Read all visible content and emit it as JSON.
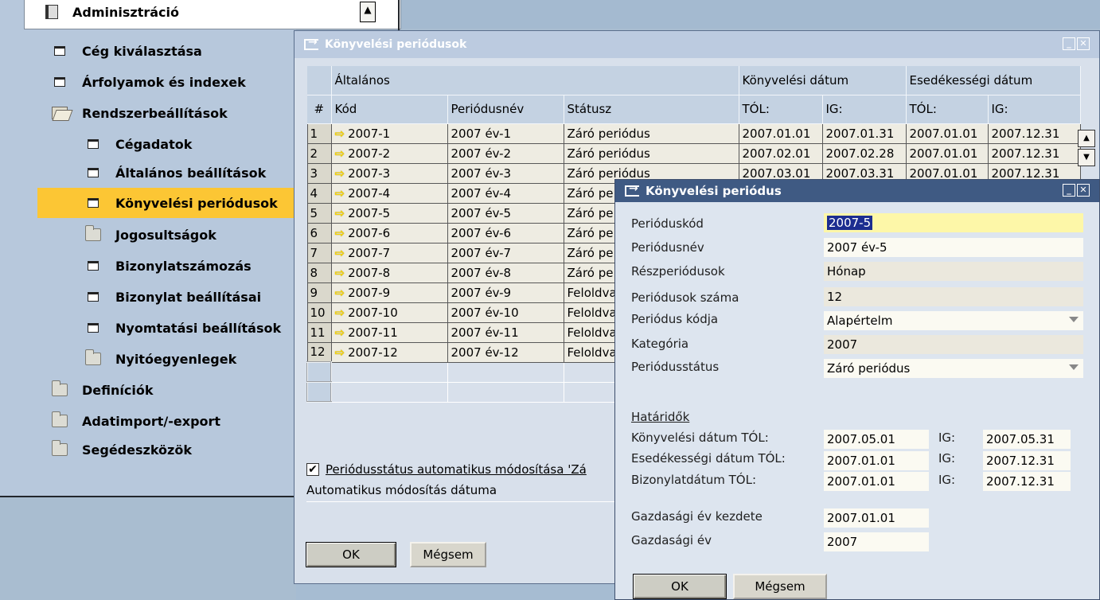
{
  "nav": {
    "scroll_up": "▲",
    "items": [
      {
        "label": "Adminisztráció",
        "icon": "book-icon"
      },
      {
        "label": "Cég kiválasztása",
        "icon": "form-icon"
      },
      {
        "label": "Árfolyamok és indexek",
        "icon": "form-icon"
      },
      {
        "label": "Rendszerbeállítások",
        "icon": "open-folder-icon"
      },
      {
        "label": "Cégadatok",
        "icon": "form-icon"
      },
      {
        "label": "Általános beállítások",
        "icon": "form-icon"
      },
      {
        "label": "Könyvelési periódusok",
        "icon": "form-icon",
        "selected": true
      },
      {
        "label": "Jogosultságok",
        "icon": "folder-icon"
      },
      {
        "label": "Bizonylatszámozás",
        "icon": "form-icon"
      },
      {
        "label": "Bizonylat beállításai",
        "icon": "form-icon"
      },
      {
        "label": "Nyomtatási beállítások",
        "icon": "form-icon"
      },
      {
        "label": "Nyitóegyenlegek",
        "icon": "folder-icon"
      },
      {
        "label": "Definíciók",
        "icon": "folder-icon"
      },
      {
        "label": "Adatimport/-export",
        "icon": "folder-icon"
      },
      {
        "label": "Segédeszközök",
        "icon": "folder-icon"
      }
    ]
  },
  "periods_window": {
    "title": "Könyvelési periódusok",
    "group_headers": {
      "general": "Általános",
      "posting_date": "Könyvelési dátum",
      "due_date": "Esedékességi dátum"
    },
    "columns": [
      "#",
      "Kód",
      "Periódusnév",
      "Státusz",
      "TÓL:",
      "IG:",
      "TÓL:",
      "IG:"
    ],
    "rows": [
      [
        "1",
        "2007-1",
        "2007 év-1",
        "Záró periódus",
        "2007.01.01",
        "2007.01.31",
        "2007.01.01",
        "2007.12.31"
      ],
      [
        "2",
        "2007-2",
        "2007 év-2",
        "Záró periódus",
        "2007.02.01",
        "2007.02.28",
        "2007.01.01",
        "2007.12.31"
      ],
      [
        "3",
        "2007-3",
        "2007 év-3",
        "Záró periódus",
        "2007.03.01",
        "2007.03.31",
        "2007.01.01",
        "2007.12.31"
      ],
      [
        "4",
        "2007-4",
        "2007 év-4",
        "Záró pe",
        "",
        "",
        "",
        ""
      ],
      [
        "5",
        "2007-5",
        "2007 év-5",
        "Záró pe",
        "",
        "",
        "",
        ""
      ],
      [
        "6",
        "2007-6",
        "2007 év-6",
        "Záró pe",
        "",
        "",
        "",
        ""
      ],
      [
        "7",
        "2007-7",
        "2007 év-7",
        "Záró pe",
        "",
        "",
        "",
        ""
      ],
      [
        "8",
        "2007-8",
        "2007 év-8",
        "Záró pe",
        "",
        "",
        "",
        ""
      ],
      [
        "9",
        "2007-9",
        "2007 év-9",
        "Feloldva",
        "",
        "",
        "",
        ""
      ],
      [
        "10",
        "2007-10",
        "2007 év-10",
        "Feloldva",
        "",
        "",
        "",
        ""
      ],
      [
        "11",
        "2007-11",
        "2007 év-11",
        "Feloldva",
        "",
        "",
        "",
        ""
      ],
      [
        "12",
        "2007-12",
        "2007 év-12",
        "Feloldva",
        "",
        "",
        "",
        ""
      ]
    ],
    "auto_status_label": "Periódusstátus automatikus módosítása 'Zá",
    "auto_status_checked": true,
    "auto_date_label": "Automatikus módosítás dátuma",
    "ok_label": "OK",
    "cancel_label": "Mégsem"
  },
  "period_dialog": {
    "title": "Könyvelési periódus",
    "fields": {
      "code": {
        "label": "Perióduskód",
        "value": "2007-5"
      },
      "name": {
        "label": "Periódusnév",
        "value": "2007 év-5"
      },
      "sub": {
        "label": "Részperiódusok",
        "value": "Hónap"
      },
      "count": {
        "label": "Periódusok száma",
        "value": "12"
      },
      "period_code": {
        "label": "Periódus kódja",
        "value": "Alapértelm"
      },
      "category": {
        "label": "Kategória",
        "value": "2007"
      },
      "status": {
        "label": "Periódusstátus",
        "value": "Záró periódus"
      }
    },
    "deadlines_title": "Határidők",
    "deadlines": [
      {
        "label": "Könyvelési dátum TÓL:",
        "from": "2007.05.01",
        "to_label": "IG:",
        "to": "2007.05.31"
      },
      {
        "label": "Esedékességi dátum TÓL:",
        "from": "2007.01.01",
        "to_label": "IG:",
        "to": "2007.12.31"
      },
      {
        "label": "Bizonylatdátum TÓL:",
        "from": "2007.01.01",
        "to_label": "IG:",
        "to": "2007.12.31"
      }
    ],
    "fiscal_start": {
      "label": "Gazdasági év kezdete",
      "value": "2007.01.01"
    },
    "fiscal_year": {
      "label": "Gazdasági év",
      "value": "2007"
    },
    "ok_label": "OK",
    "cancel_label": "Mégsem"
  },
  "colors": {
    "selection": "#fcc634",
    "dialog_title": "#3f5a83",
    "required_field": "#fdf7a8"
  }
}
